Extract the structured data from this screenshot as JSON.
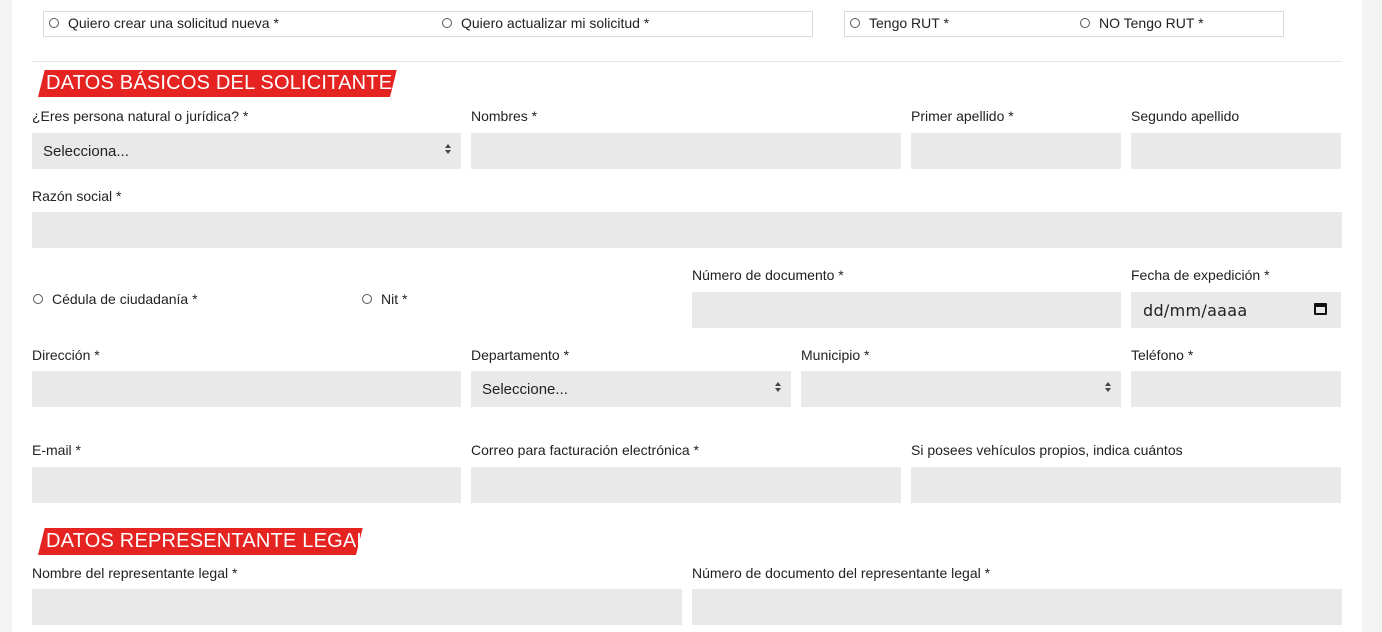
{
  "request_type": {
    "option_new": "Quiero crear una solicitud nueva *",
    "option_update": "Quiero actualizar mi solicitud *"
  },
  "rut": {
    "option_has": "Tengo RUT *",
    "option_not": "NO Tengo RUT *"
  },
  "section_basic": {
    "title": "DATOS BÁSICOS DEL SOLICITANTE",
    "person_type_label": "¿Eres persona natural o jurídica? *",
    "person_type_value": "Selecciona...",
    "names_label": "Nombres *",
    "first_surname_label": "Primer apellido *",
    "second_surname_label": "Segundo apellido",
    "company_name_label": "Razón social *",
    "doc_type_cc": "Cédula de ciudadanía *",
    "doc_type_nit": "Nit *",
    "doc_number_label": "Número de documento *",
    "issue_date_label": "Fecha de expedición *",
    "issue_date_placeholder": "dd/mm/aaaa",
    "address_label": "Dirección *",
    "department_label": "Departamento *",
    "department_value": "Seleccione...",
    "municipality_label": "Municipio *",
    "municipality_value": "",
    "phone_label": "Teléfono *",
    "email_label": "E-mail *",
    "billing_email_label": "Correo para facturación electrónica *",
    "vehicles_label": "Si posees vehículos propios, indica cuántos"
  },
  "section_legal": {
    "title": "DATOS REPRESENTANTE LEGAL",
    "rep_name_label": "Nombre del representante legal *",
    "rep_doc_label": "Número de documento del representante legal *"
  },
  "colors": {
    "accent": "#e52421",
    "input_bg": "#e9e9e9"
  }
}
